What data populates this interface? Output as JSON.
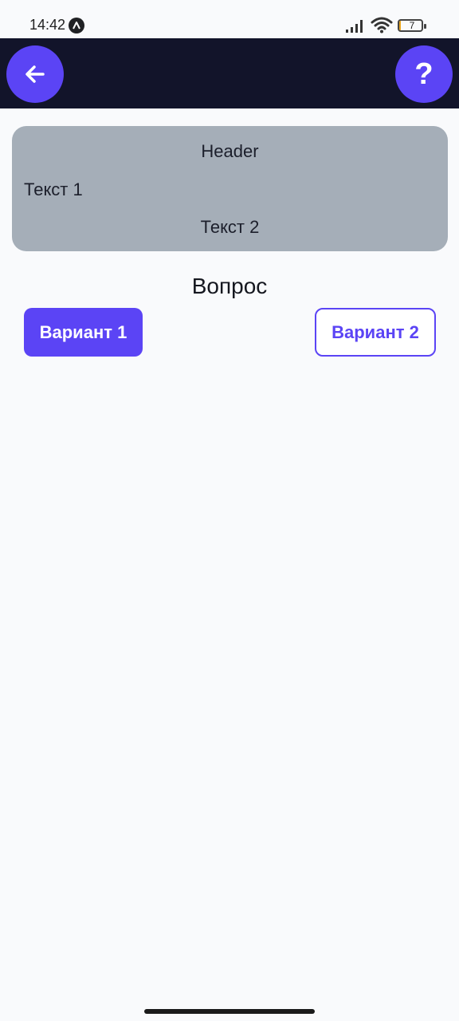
{
  "status_bar": {
    "time": "14:42",
    "app_badge_icon": "app-badge-icon",
    "signal_icon": "signal-icon",
    "wifi_icon": "wifi-icon",
    "battery_level": "7",
    "battery_fraction": 0.07
  },
  "app_bar": {
    "back_icon": "arrow-left-icon",
    "help_label": "?",
    "background_color": "#12142a",
    "button_color": "#5b44f5"
  },
  "card": {
    "header": "Header",
    "text_1": "Текст 1",
    "text_2": "Текст 2",
    "background_color": "#a5aeb8"
  },
  "question": {
    "text": "Вопрос"
  },
  "options": [
    {
      "label": "Вариант 1",
      "style": "filled"
    },
    {
      "label": "Вариант 2",
      "style": "outlined"
    }
  ],
  "accent_color": "#5b44f5"
}
